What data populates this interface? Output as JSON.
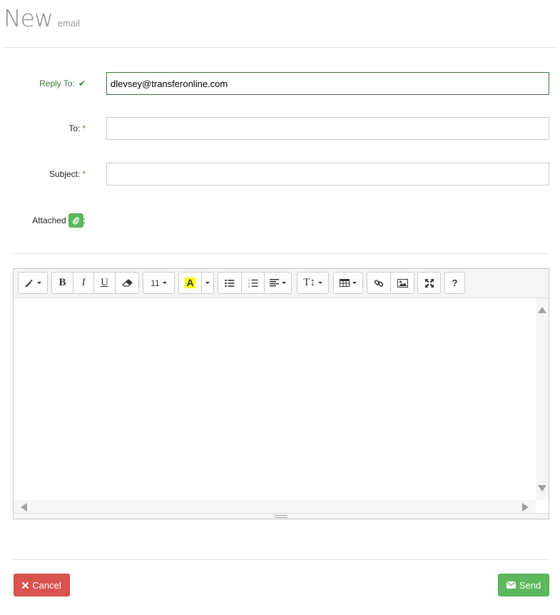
{
  "header": {
    "title": "New",
    "subtitle": "email"
  },
  "form": {
    "reply_to": {
      "label": "Reply To:",
      "value": "dlevsey@transferonline.com",
      "status": "valid"
    },
    "to": {
      "label": "To:",
      "required_mark": "*",
      "value": ""
    },
    "subject": {
      "label": "Subject:",
      "required_mark": "*",
      "value": ""
    },
    "attached": {
      "label": "Attached",
      "suffix": ":"
    }
  },
  "toolbar": {
    "font_size": "11",
    "text_style": "T↕",
    "bold": "B",
    "italic": "I",
    "underline": "U",
    "highlight": "A",
    "help": "?",
    "icons": [
      "magic-wand-icon",
      "bold-icon",
      "italic-icon",
      "underline-icon",
      "eraser-icon",
      "font-size-icon",
      "highlight-color-icon",
      "bullet-list-icon",
      "numbered-list-icon",
      "align-icon",
      "text-height-icon",
      "table-icon",
      "link-icon",
      "image-icon",
      "fullscreen-icon",
      "help-icon"
    ]
  },
  "editor": {
    "content": ""
  },
  "actions": {
    "cancel": "Cancel",
    "send": "Send"
  },
  "colors": {
    "success": "#5cb85c",
    "danger": "#d9534f",
    "valid_text": "#3c763d",
    "highlight": "#ffff00"
  }
}
